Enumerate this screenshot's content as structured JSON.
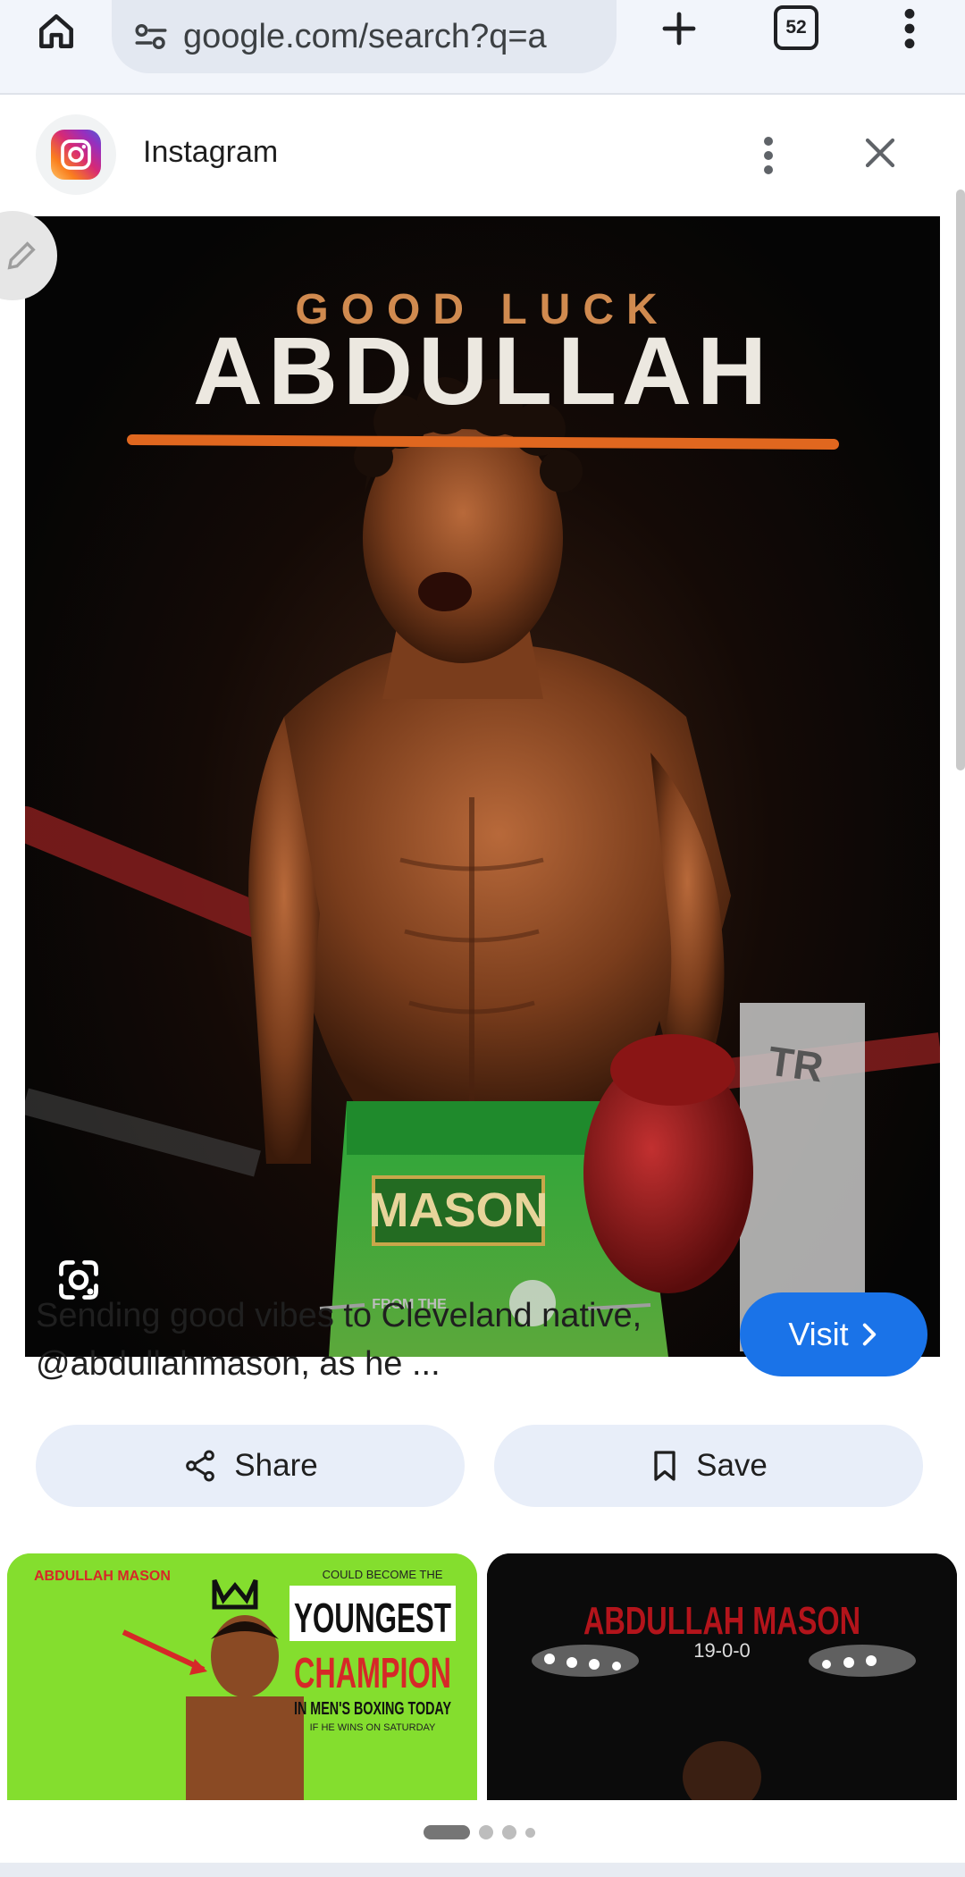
{
  "browser": {
    "url": "google.com/search?q=a",
    "tab_count": "52"
  },
  "panel": {
    "source_name": "Instagram"
  },
  "image": {
    "headline_small": "GOOD LUCK",
    "headline_big": "ABDULLAH",
    "trunks_text": "MASON",
    "footer_text": "FROM THE"
  },
  "result": {
    "caption": "Sending good vibes to Cleveland native, @abdullahmason, as he ...",
    "visit_label": "Visit",
    "share_label": "Share",
    "save_label": "Save"
  },
  "related": [
    {
      "name_tag": "ABDULLAH MASON",
      "line1": "COULD BECOME THE",
      "line2": "YOUNGEST",
      "line3": "CHAMPION",
      "line4": "IN MEN'S BOXING TODAY",
      "line5": "IF HE WINS ON SATURDAY"
    },
    {
      "title": "ABDULLAH MASON",
      "record": "19-0-0"
    }
  ],
  "pager": {
    "active_index": 0,
    "count": 4
  },
  "colors": {
    "accent": "#1a73e8",
    "pill_bg": "#e8eef9",
    "toolbar_bg": "#f2f5fb"
  }
}
